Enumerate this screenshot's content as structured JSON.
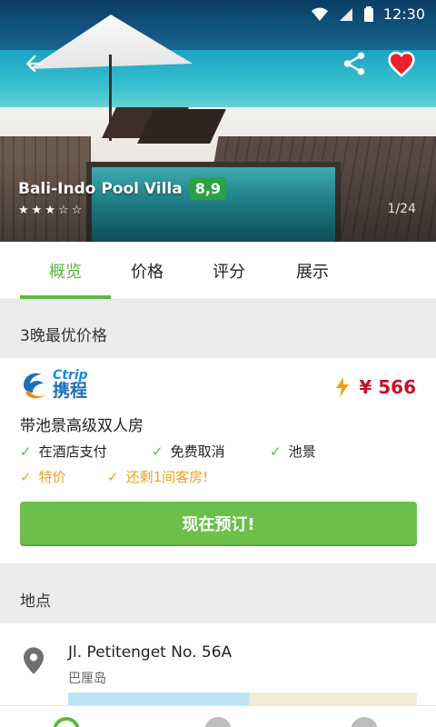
{
  "status_bar": {
    "time": "12:30",
    "icons": [
      "wifi-icon",
      "signal-icon",
      "battery-icon"
    ]
  },
  "hero": {
    "hotel_name": "Bali-Indo Pool Villa",
    "score": "8,9",
    "stars_total": 5,
    "stars_filled": 3,
    "photo_counter": "1/24",
    "icons": {
      "back": "arrow-left-icon",
      "share": "share-icon",
      "favorite": "heart-icon"
    },
    "favorite_color": "#e8232a"
  },
  "tabs": [
    {
      "label": "概览",
      "active": true
    },
    {
      "label": "价格",
      "active": false
    },
    {
      "label": "评分",
      "active": false
    },
    {
      "label": "展示",
      "active": false
    }
  ],
  "best_price": {
    "section_title": "3晚最优价格",
    "provider": {
      "logo_text_en": "Ctrip",
      "logo_text_cn": "携程"
    },
    "price": "¥ 566",
    "room_name": "带池景高级双人房",
    "amenities": [
      {
        "label": "在酒店支付",
        "style": "green"
      },
      {
        "label": "免费取消",
        "style": "green"
      },
      {
        "label": "池景",
        "style": "green"
      },
      {
        "label": "特价",
        "style": "orange"
      },
      {
        "label": "还剩1间客房!",
        "style": "orange"
      }
    ],
    "book_button": "现在预订!"
  },
  "location": {
    "section_title": "地点",
    "address": "Jl. Petitenget No. 56A",
    "city": "巴厘岛"
  },
  "colors": {
    "accent_green": "#5cb93f",
    "button_green": "#6cc04a",
    "price_red": "#c8102e",
    "orange": "#f0a020",
    "ctrip_blue": "#1b70b8"
  }
}
